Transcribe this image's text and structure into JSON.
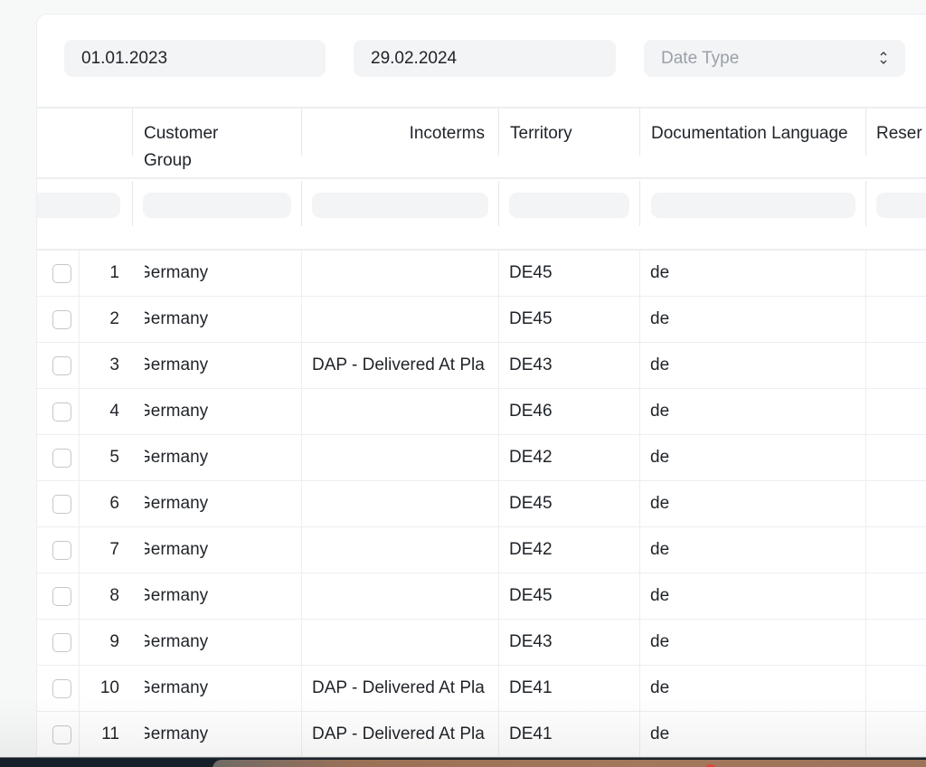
{
  "filters": {
    "from_date": "01.01.2023",
    "to_date": "29.02.2024",
    "date_type_placeholder": "Date Type"
  },
  "table": {
    "columns": [
      {
        "key": "customer_group",
        "label_line1": "Customer",
        "label_line2": "Group"
      },
      {
        "key": "incoterms",
        "label": "Incoterms"
      },
      {
        "key": "territory",
        "label": "Territory"
      },
      {
        "key": "documentation_language",
        "label": "Documentation Language"
      },
      {
        "key": "reserved",
        "label": "Reser"
      }
    ],
    "rows": [
      {
        "num": "1",
        "customer_group": "Germany",
        "incoterms": "",
        "territory": "DE45",
        "language": "de"
      },
      {
        "num": "2",
        "customer_group": "Germany",
        "incoterms": "",
        "territory": "DE45",
        "language": "de"
      },
      {
        "num": "3",
        "customer_group": "Germany",
        "incoterms": "DAP - Delivered At Pla",
        "territory": "DE43",
        "language": "de"
      },
      {
        "num": "4",
        "customer_group": "Germany",
        "incoterms": "",
        "territory": "DE46",
        "language": "de"
      },
      {
        "num": "5",
        "customer_group": "Germany",
        "incoterms": "",
        "territory": "DE42",
        "language": "de"
      },
      {
        "num": "6",
        "customer_group": "Germany",
        "incoterms": "",
        "territory": "DE45",
        "language": "de"
      },
      {
        "num": "7",
        "customer_group": "Germany",
        "incoterms": "",
        "territory": "DE42",
        "language": "de"
      },
      {
        "num": "8",
        "customer_group": "Germany",
        "incoterms": "",
        "territory": "DE45",
        "language": "de"
      },
      {
        "num": "9",
        "customer_group": "Germany",
        "incoterms": "",
        "territory": "DE43",
        "language": "de"
      },
      {
        "num": "10",
        "customer_group": "Germany",
        "incoterms": "DAP - Delivered At Pla",
        "territory": "DE41",
        "language": "de"
      },
      {
        "num": "11",
        "customer_group": "Germany",
        "incoterms": "DAP - Delivered At Pla",
        "territory": "DE41",
        "language": "de"
      }
    ]
  }
}
